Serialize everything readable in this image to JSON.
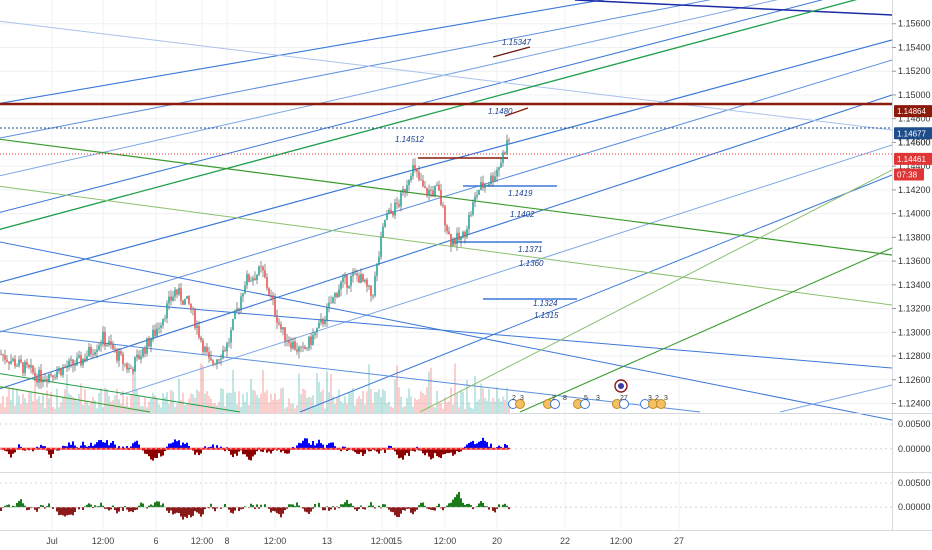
{
  "chart_data": {
    "type": "candlestick",
    "price_axis": {
      "ticks": [
        "1.15600",
        "1.15400",
        "1.15200",
        "1.15000",
        "1.14800",
        "1.14600",
        "1.14400",
        "1.14200",
        "1.14000",
        "1.13800",
        "1.13600",
        "1.13400",
        "1.13200",
        "1.13000",
        "1.12800",
        "1.12600",
        "1.12400"
      ],
      "range": [
        1.1232,
        1.158
      ]
    },
    "price_badges": [
      {
        "text": "1.14864",
        "value": 1.14864,
        "color": "#8b1a0a"
      },
      {
        "text": "1.14677",
        "value": 1.14677,
        "color": "#1e4d8c"
      },
      {
        "text": "1.14461",
        "value": 1.14461,
        "color": "#e03535"
      },
      {
        "text": "07:38",
        "value": 1.1433,
        "color": "#e03535"
      }
    ],
    "partial_axis_text": "1.14600",
    "x_axis": {
      "labels": [
        "Jul",
        "12:00",
        "6",
        "12:00",
        "8",
        "12:00",
        "13",
        "12:00",
        "15",
        "12:00",
        "20",
        "22",
        "12:00",
        "27"
      ]
    },
    "level_labels": [
      "1.15347",
      "1.1480",
      "1.14512",
      "1.1419",
      "1.1402",
      "1.1371",
      "1.1360",
      "1.1324",
      "1.1315"
    ],
    "event_markers": [
      "2",
      "3",
      "2",
      "8",
      "5",
      "3",
      "27",
      "3",
      "2",
      "3"
    ],
    "oscillator_1": {
      "ticks": [
        "0.00500",
        "0.00000"
      ],
      "range": [
        -0.0075,
        0.0075
      ]
    },
    "oscillator_2": {
      "ticks": [
        "0.00500",
        "0.00000"
      ],
      "range": [
        -0.0075,
        0.0075
      ]
    },
    "colors": {
      "bull": "#26a69a",
      "bear": "#ef5350",
      "wick": "#444444",
      "osc1_up": "#0000ff",
      "osc1_down": "#8b0000",
      "osc1_line": "#ff2020",
      "osc2_up": "#1b7a1b",
      "osc2_down": "#8b1a1a",
      "grid": "#eef0f3",
      "axis_text": "#333333"
    }
  }
}
